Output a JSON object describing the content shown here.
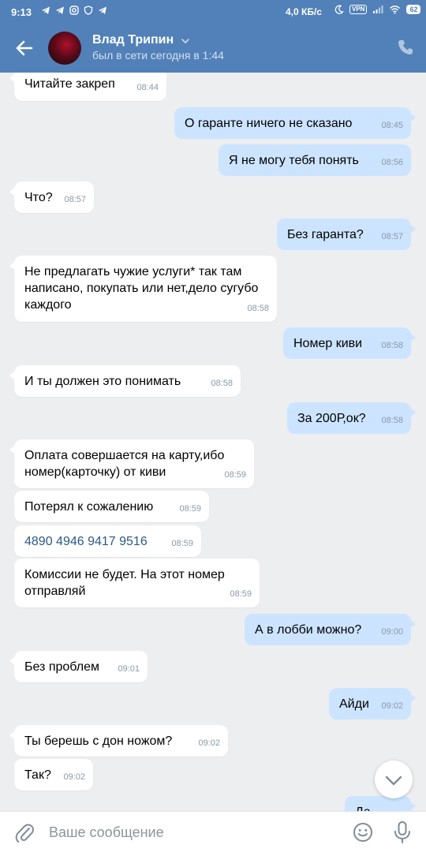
{
  "status_bar": {
    "time": "9:13",
    "speed": "4,0 КБ/с",
    "vpn": "VPN",
    "battery": "62"
  },
  "header": {
    "name": "Влад Трипин",
    "last_seen": "был в сети сегодня в 1:44"
  },
  "messages": [
    {
      "dir": "in",
      "text": "Читайте закреп",
      "time": "08:44"
    },
    {
      "dir": "out",
      "text": "О гаранте ничего не сказано",
      "time": "08:45"
    },
    {
      "dir": "out",
      "text": "Я не могу тебя понять",
      "time": "08:56"
    },
    {
      "dir": "in",
      "text": "Что?",
      "time": "08:57"
    },
    {
      "dir": "out",
      "text": "Без гаранта?",
      "time": "08:57"
    },
    {
      "dir": "in",
      "text": "Не предлагать чужие услуги* так там написано, покупать или нет,дело сугубо каждого",
      "time": "08:58"
    },
    {
      "dir": "out",
      "text": "Номер киви",
      "time": "08:58"
    },
    {
      "dir": "in",
      "text": "И ты должен это понимать",
      "time": "08:58"
    },
    {
      "dir": "out",
      "text": "За 200Р,ок?",
      "time": "08:58"
    },
    {
      "dir": "in",
      "text": "Оплата совершается на карту,ибо номер(карточку) от киви",
      "time": "08:59"
    },
    {
      "dir": "in",
      "text": "Потерял к сожалению",
      "time": "08:59"
    },
    {
      "dir": "in",
      "text": "4890 4946 9417 9516",
      "time": "08:59"
    },
    {
      "dir": "in",
      "text": "Комиссии не будет. На этот номер отправляй",
      "time": "08:59"
    },
    {
      "dir": "out",
      "text": "А в лобби можно?",
      "time": "09:00"
    },
    {
      "dir": "in",
      "text": "Без проблем",
      "time": "09:01"
    },
    {
      "dir": "out",
      "text": "Айди",
      "time": "09:02"
    },
    {
      "dir": "in",
      "text": "Ты берешь с дон ножом?",
      "time": "09:02"
    },
    {
      "dir": "in",
      "text": "Так?",
      "time": "09:02"
    },
    {
      "dir": "out",
      "text": "Да",
      "time": ""
    }
  ],
  "composer": {
    "placeholder": "Ваше сообщение"
  },
  "icons": {
    "back": "arrow-left-icon",
    "call": "phone-icon",
    "attach": "paperclip-icon",
    "emoji": "smile-icon",
    "mic": "microphone-icon",
    "scroll_down": "chevron-down-icon"
  },
  "colors": {
    "header": "#5181b8",
    "bubble_in": "#ffffff",
    "bubble_out": "#cce4ff",
    "background": "#edeef0",
    "link": "#2a5885"
  }
}
